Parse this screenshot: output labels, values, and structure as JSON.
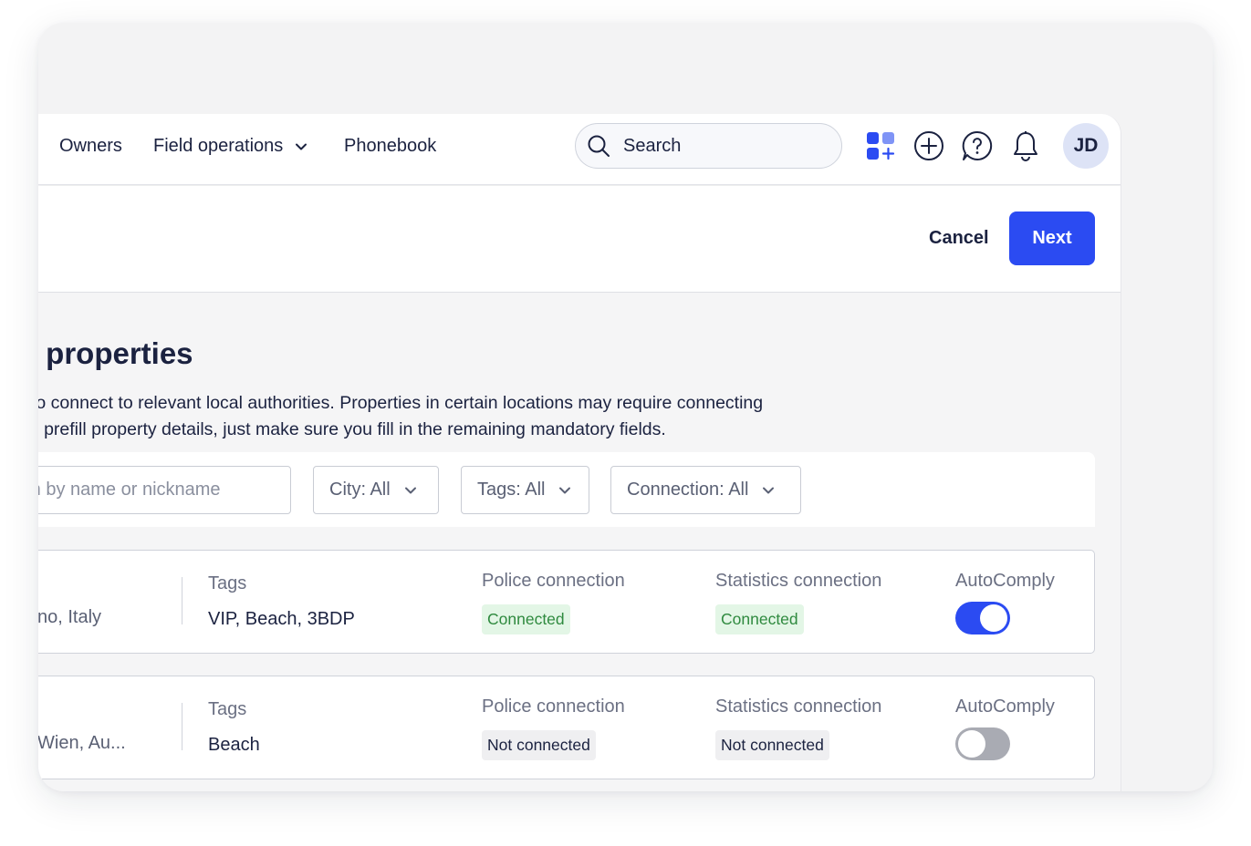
{
  "nav": {
    "items": [
      {
        "label": "Owners"
      },
      {
        "label": "Field operations"
      },
      {
        "label": "Phonebook"
      }
    ],
    "search_placeholder": "Search",
    "avatar_initials": "JD"
  },
  "actions": {
    "cancel_label": "Cancel",
    "next_label": "Next"
  },
  "page": {
    "title": "t properties",
    "description_line1": "to connect to relevant local authorities. Properties in certain locations may require connecting",
    "description_line2": "ll prefill property details, just make sure you fill in the remaining mandatory fields."
  },
  "filters": {
    "name_search_placeholder": "rch by name or nickname",
    "city": "City: All",
    "tags": "Tags: All",
    "connection": "Connection: All"
  },
  "rows": [
    {
      "location": "no, Italy",
      "tags_label": "Tags",
      "tags": "VIP, Beach, 3BDP",
      "police_label": "Police connection",
      "police_status": "Connected",
      "stats_label": "Statistics connection",
      "stats_status": "Connected",
      "autocomply_label": "AutoComply",
      "autocomply_on": true
    },
    {
      "location": "Wien, Au...",
      "tags_label": "Tags",
      "tags": "Beach",
      "police_label": "Police connection",
      "police_status": "Not connected",
      "stats_label": "Statistics connection",
      "stats_status": "Not connected",
      "autocomply_label": "AutoComply",
      "autocomply_on": false
    }
  ],
  "colors": {
    "accent": "#2b4bf2",
    "connected_bg": "#e3f6e6",
    "connected_text": "#2f8a3f",
    "not_connected_bg": "#efeff1"
  }
}
